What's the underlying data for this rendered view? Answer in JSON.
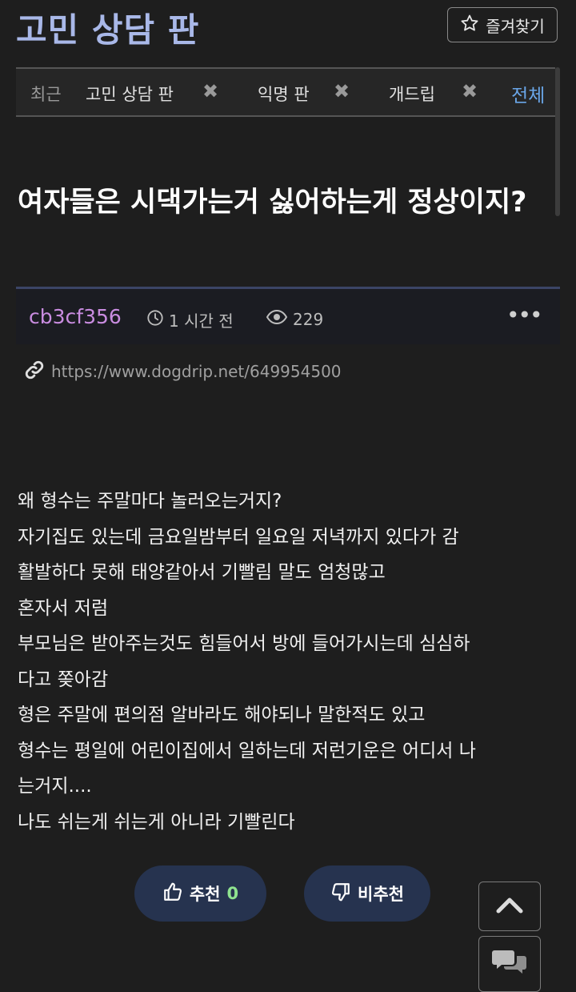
{
  "board": {
    "title": "고민 상담 판",
    "favorite_label": "즐겨찾기"
  },
  "tabs": {
    "recent_label": "최근",
    "items": [
      {
        "label": "고민 상담 판",
        "close": "✖"
      },
      {
        "label": "익명 판",
        "close": "✖"
      },
      {
        "label": "개드립",
        "close": "✖"
      }
    ],
    "all_label": "전체"
  },
  "post": {
    "title": "여자들은 시댁가는거 싫어하는게 정상이지?",
    "author": "cb3cf356",
    "time": "1 시간 전",
    "views": "229",
    "more": "•••",
    "url": "https://www.dogdrip.net/649954500",
    "lines": [
      "왜 형수는 주말마다 놀러오는거지?",
      "자기집도 있는데 금요일밤부터 일요일 저녁까지 있다가 감",
      "활발하다 못해 태양같아서 기빨림 말도 엄청많고",
      "혼자서 저럼",
      "부모님은 받아주는것도 힘들어서 방에 들어가시는데 심심하",
      "다고 쫒아감",
      "형은 주말에 편의점 알바라도 해야되나 말한적도 있고",
      "형수는 평일에 어린이집에서 일하는데 저런기운은 어디서 나",
      "는거지....",
      "나도 쉬는게 쉬는게 아니라 기빨린다"
    ]
  },
  "actions": {
    "upvote_label": "추천",
    "upvote_count": "0",
    "downvote_label": "비추천"
  },
  "colors": {
    "title": "#a9b8e8",
    "author": "#c98ce0",
    "tab_all": "#6aa6e8",
    "vote_bg": "#26334f",
    "vote_count": "#8fe38f"
  }
}
